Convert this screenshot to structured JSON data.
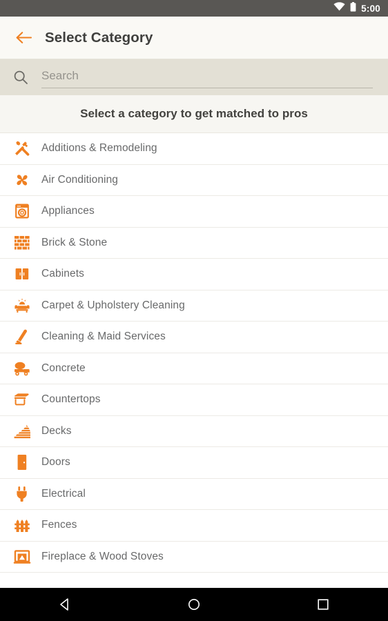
{
  "statusbar": {
    "time": "5:00",
    "wifi_icon": "wifi-icon",
    "battery_icon": "battery-icon"
  },
  "toolbar": {
    "back_icon": "back-arrow-icon",
    "title": "Select Category",
    "accent_color": "#ef8022",
    "background": "#faf9f5",
    "title_color": "#40403e"
  },
  "search": {
    "icon": "search-icon",
    "placeholder": "Search",
    "value": "",
    "background": "#e3e0d5"
  },
  "prompt": {
    "text": "Select a category to get matched to pros",
    "background": "#f7f6f2"
  },
  "list": {
    "items": [
      {
        "label": "Additions & Remodeling",
        "icon": "hammer-wrench-icon"
      },
      {
        "label": "Air Conditioning",
        "icon": "fan-icon"
      },
      {
        "label": "Appliances",
        "icon": "washing-machine-icon"
      },
      {
        "label": "Brick & Stone",
        "icon": "brick-wall-icon"
      },
      {
        "label": "Cabinets",
        "icon": "cabinet-icon"
      },
      {
        "label": "Carpet & Upholstery Cleaning",
        "icon": "sofa-sparkle-icon"
      },
      {
        "label": "Cleaning & Maid Services",
        "icon": "vacuum-icon"
      },
      {
        "label": "Concrete",
        "icon": "cement-mixer-icon"
      },
      {
        "label": "Countertops",
        "icon": "countertop-icon"
      },
      {
        "label": "Decks",
        "icon": "deck-stairs-icon"
      },
      {
        "label": "Doors",
        "icon": "door-icon"
      },
      {
        "label": "Electrical",
        "icon": "power-plug-icon"
      },
      {
        "label": "Fences",
        "icon": "fence-icon"
      },
      {
        "label": "Fireplace & Wood Stoves",
        "icon": "fireplace-icon"
      }
    ],
    "icon_color": "#ef8022",
    "label_color": "#68696a"
  },
  "navbar": {
    "back_label": "Back",
    "home_label": "Home",
    "recents_label": "Recent apps",
    "background": "#000000"
  }
}
